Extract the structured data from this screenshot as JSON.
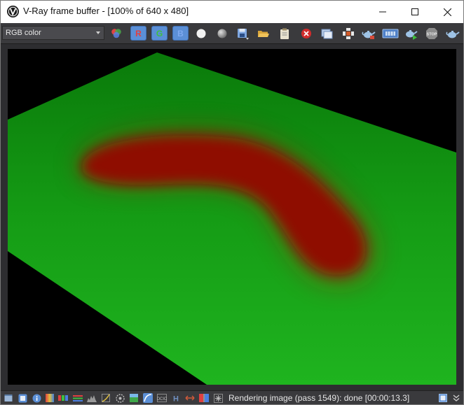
{
  "window": {
    "title": "V-Ray frame buffer - [100% of 640 x 480]",
    "minimize_icon": "minimize-icon",
    "maximize_icon": "maximize-icon",
    "close_icon": "close-icon"
  },
  "toolbar": {
    "channel_select": {
      "value": "RGB color"
    },
    "red_channel_label": "R",
    "green_channel_label": "G",
    "blue_channel_label": "B",
    "colors": {
      "channel_button": "#5b8fd6",
      "red": "#e04040",
      "green": "#3fbf3f",
      "blue": "#7faaf0"
    }
  },
  "render": {
    "colors": {
      "background": "#000000",
      "plane_green": "#1aa51a",
      "blob_red": "#8f0a06"
    }
  },
  "statusbar": {
    "text": "Rendering image (pass 1549): done [00:00:13.3]"
  }
}
